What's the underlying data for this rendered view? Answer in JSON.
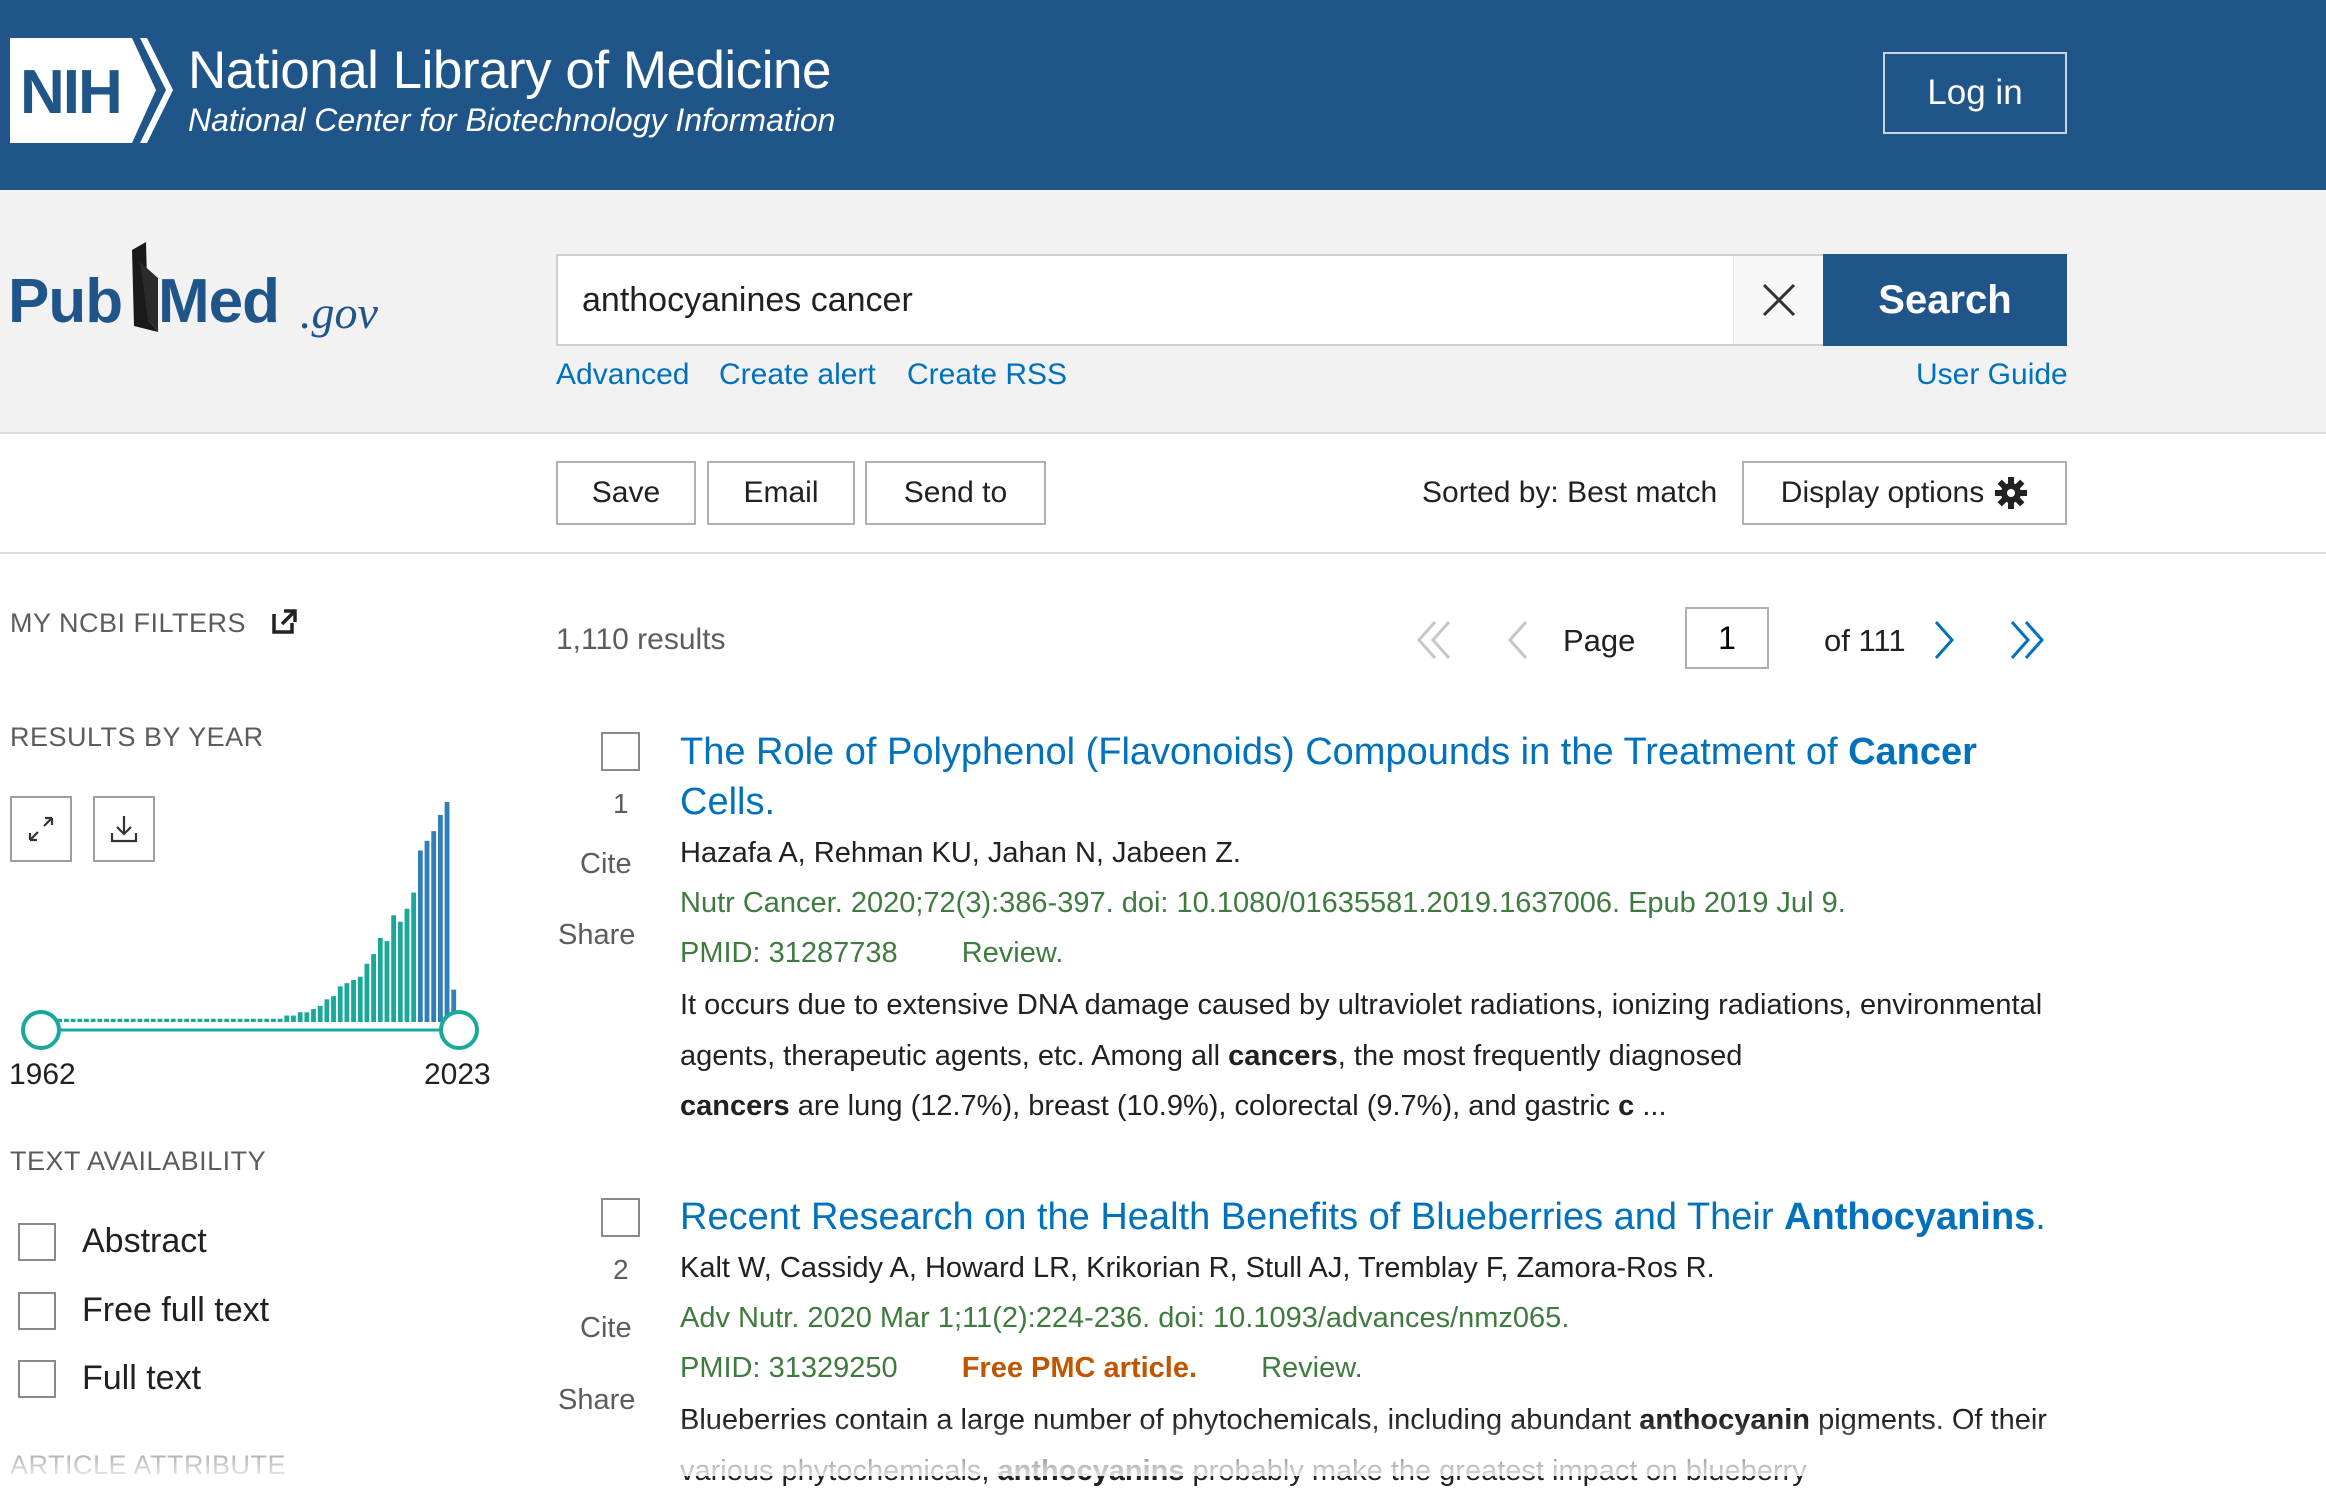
{
  "header": {
    "logo_text": "NIH",
    "title": "National Library of Medicine",
    "subtitle": "National Center for Biotechnology Information",
    "login_label": "Log in"
  },
  "search": {
    "logo_left": "Pub",
    "logo_right": "Med",
    "logo_suffix": ".gov",
    "query": "anthocyanines cancer",
    "button_label": "Search",
    "links": {
      "advanced": "Advanced",
      "create_alert": "Create alert",
      "create_rss": "Create RSS",
      "user_guide": "User Guide"
    }
  },
  "toolbar": {
    "save": "Save",
    "email": "Email",
    "send_to": "Send to",
    "sorted_by": "Sorted by: Best match",
    "display_options": "Display options"
  },
  "sidebar": {
    "my_filters": "MY NCBI FILTERS",
    "results_by_year": "RESULTS BY YEAR",
    "year_start": "1962",
    "year_end": "2023",
    "text_availability": "TEXT AVAILABILITY",
    "filters": [
      {
        "label": "Abstract",
        "checked": false
      },
      {
        "label": "Free full text",
        "checked": false
      },
      {
        "label": "Full text",
        "checked": false
      }
    ],
    "article_attribute": "ARTICLE ATTRIBUTE"
  },
  "pagination": {
    "results_count": "1,110 results",
    "page_label": "Page",
    "page_value": "1",
    "of_label": "of 111"
  },
  "results": [
    {
      "num": "1",
      "title_plain": "The Role of Polyphenol (Flavonoids) Compounds in the Treatment of ",
      "title_bold": "Cancer",
      "title_rest": " Cells.",
      "authors": "Hazafa A, Rehman KU, Jahan N, Jabeen Z.",
      "citation": "Nutr Cancer. 2020;72(3):386-397. doi: 10.1080/01635581.2019.1637006. Epub 2019 Jul 9.",
      "pmid": "PMID: 31287738",
      "type": "Review.",
      "snippet_1": "It occurs due to extensive DNA damage caused by ultraviolet radiations, ionizing radiations, environmental agents, therapeutic agents, etc. Among all ",
      "snippet_b1": "cancers",
      "snippet_2": ", the most frequently diagnosed ",
      "snippet_b2": "cancers",
      "snippet_3": " are lung (12.7%), breast (10.9%), colorectal (9.7%), and gastric ",
      "snippet_b3": "c",
      "snippet_4": " ..."
    },
    {
      "num": "2",
      "title_plain": "Recent Research on the Health Benefits of Blueberries and Their ",
      "title_bold": "Anthocyanins",
      "title_rest": ".",
      "authors": "Kalt W, Cassidy A, Howard LR, Krikorian R, Stull AJ, Tremblay F, Zamora-Ros R.",
      "citation": "Adv Nutr. 2020 Mar 1;11(2):224-236. doi: 10.1093/advances/nmz065.",
      "pmid": "PMID: 31329250",
      "free_pmc": "Free PMC article.",
      "type": "Review.",
      "snippet_1": "Blueberries contain a large number of phytochemicals, including abundant ",
      "snippet_b1": "anthocyanin",
      "snippet_2": " pigments. Of their various phytochemicals, ",
      "snippet_b2": "anthocyanins",
      "snippet_3": " probably make the greatest impact on blueberry"
    }
  ],
  "actions": {
    "cite": "Cite",
    "share": "Share"
  },
  "icons": [
    "nih-logo",
    "clear-icon",
    "gear-icon",
    "external-link-icon",
    "expand-icon",
    "download-icon",
    "first-page-icon",
    "prev-page-icon",
    "next-page-icon",
    "last-page-icon"
  ],
  "colors": {
    "header_bg": "#20558a",
    "link": "#0071bc",
    "citation": "#3f7a3f",
    "free_pmc": "#c05600",
    "histogram": "#1aa89a",
    "histogram_recent": "#2f7fb8"
  },
  "chart_data": {
    "type": "bar",
    "x": [
      1962,
      2023
    ],
    "values": [
      1,
      1,
      1,
      1,
      1,
      1,
      1,
      1,
      1,
      1,
      1,
      1,
      1,
      1,
      1,
      1,
      1,
      1,
      1,
      1,
      1,
      1,
      1,
      1,
      1,
      1,
      1,
      1,
      1,
      1,
      1,
      1,
      1,
      1,
      1,
      1,
      2,
      2,
      3,
      3,
      4,
      5,
      7,
      8,
      11,
      12,
      13,
      14,
      18,
      21,
      26,
      25,
      33,
      31,
      35,
      40,
      53,
      56,
      59,
      64,
      68,
      10
    ],
    "recent_from_index": 56
  }
}
